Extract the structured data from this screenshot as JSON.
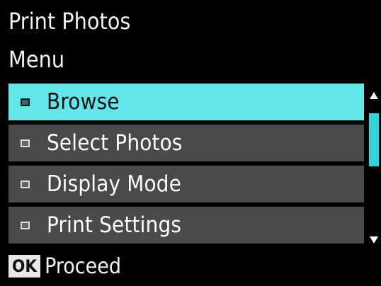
{
  "header": {
    "title": "Print Photos",
    "subtitle": "Menu"
  },
  "menu": {
    "items": [
      {
        "label": "Browse",
        "selected": true
      },
      {
        "label": "Select Photos",
        "selected": false
      },
      {
        "label": "Display Mode",
        "selected": false
      },
      {
        "label": "Print Settings",
        "selected": false
      }
    ]
  },
  "footer": {
    "ok_label": "OK",
    "action_text": "Proceed"
  },
  "colors": {
    "background": "#000000",
    "item_background": "#4a4a4a",
    "selected_background": "#63e6ea",
    "scroll_thumb": "#2fd4de"
  },
  "icons": {
    "scroll_up": "triangle-up-icon",
    "scroll_down": "triangle-down-icon",
    "bullet": "square-bullet-icon"
  }
}
